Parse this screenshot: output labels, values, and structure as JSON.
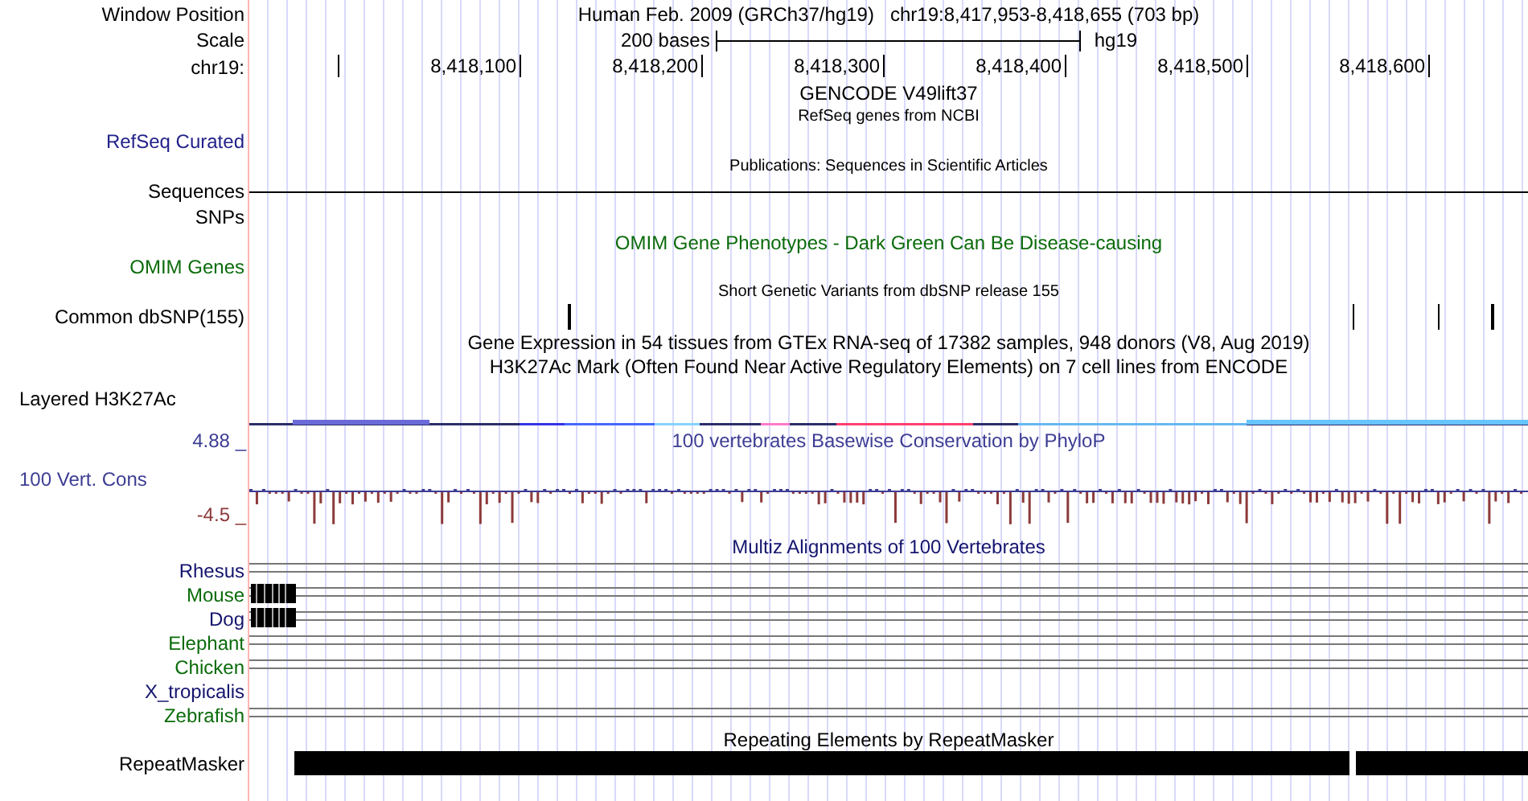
{
  "header": {
    "label": "Window Position",
    "assembly": "Human Feb. 2009 (GRCh37/hg19)",
    "position": "chr19:8,417,953-8,418,655 (703 bp)"
  },
  "scale": {
    "label": "Scale",
    "length": "200 bases",
    "assembly": "hg19"
  },
  "ruler": {
    "label": "chr19:",
    "ticks": [
      "8,418,100",
      "8,418,200",
      "8,418,300",
      "8,418,400",
      "8,418,500",
      "8,418,600"
    ]
  },
  "tracks": [
    {
      "kind": "title",
      "text": "GENCODE V49lift37"
    },
    {
      "kind": "caption",
      "text": "RefSeq genes from NCBI"
    },
    {
      "kind": "label",
      "label": "RefSeq Curated",
      "color": "#22228a"
    },
    {
      "kind": "caption",
      "text": "Publications: Sequences in Scientific Articles"
    },
    {
      "kind": "line",
      "label": "Sequences"
    },
    {
      "kind": "label",
      "label": "SNPs"
    },
    {
      "kind": "title",
      "text": "OMIM Gene Phenotypes - Dark Green Can Be Disease-causing",
      "color": "#0b6b0b"
    },
    {
      "kind": "label",
      "label": "OMIM Genes",
      "color": "#0b6b0b"
    },
    {
      "kind": "caption",
      "text": "Short Genetic Variants from dbSNP release 155"
    },
    {
      "kind": "snps",
      "label": "Common dbSNP(155)"
    },
    {
      "kind": "title",
      "text": "Gene Expression in 54 tissues from GTEx RNA-seq of 17382 samples, 948 donors (V8, Aug 2019)"
    },
    {
      "kind": "title",
      "text": "H3K27Ac Mark (Often Found Near Active Regulatory Elements) on 7 cell lines from ENCODE"
    },
    {
      "kind": "signal",
      "label": "Layered H3K27Ac"
    },
    {
      "kind": "wiggle",
      "label": "100 Vert. Cons",
      "max": "4.88 _",
      "min": "-4.5 _",
      "text": "100 vertebrates Basewise Conservation by PhyloP",
      "color": "#3d3d94"
    },
    {
      "kind": "title",
      "text": "Multiz Alignments of 100 Vertebrates",
      "color": "#14146e"
    },
    {
      "kind": "species",
      "label": "Rhesus",
      "color": "#14146e",
      "aligned": true,
      "blocks": false
    },
    {
      "kind": "species",
      "label": "Mouse",
      "color": "#0b6b0b",
      "aligned": true,
      "blocks": true
    },
    {
      "kind": "species",
      "label": "Dog",
      "color": "#14146e",
      "aligned": true,
      "blocks": true
    },
    {
      "kind": "species",
      "label": "Elephant",
      "color": "#0b6b0b",
      "aligned": true,
      "blocks": false
    },
    {
      "kind": "species",
      "label": "Chicken",
      "color": "#0b6b0b",
      "aligned": true,
      "blocks": false
    },
    {
      "kind": "species",
      "label": "X_tropicalis",
      "color": "#14146e",
      "aligned": false,
      "blocks": false
    },
    {
      "kind": "species",
      "label": "Zebrafish",
      "color": "#0b6b0b",
      "aligned": true,
      "blocks": false
    },
    {
      "kind": "title",
      "text": "Repeating Elements by RepeatMasker"
    },
    {
      "kind": "bar",
      "label": "RepeatMasker"
    }
  ]
}
